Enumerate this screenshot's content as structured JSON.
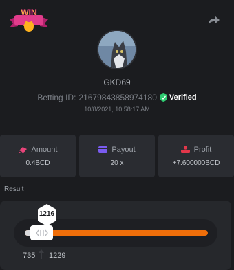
{
  "logo": {
    "text": "WIN"
  },
  "user": {
    "name": "GKD69",
    "betting_id_label": "Betting ID:",
    "betting_id": "21679843858974180",
    "verified": "Verified",
    "datetime": "10/8/2021, 10:58:17 AM"
  },
  "stats": {
    "amount_label": "Amount",
    "amount_value": "0.4BCD",
    "payout_label": "Payout",
    "payout_value": "20 x",
    "profit_label": "Profit",
    "profit_value": "+7.600000BCD"
  },
  "result": {
    "label": "Result",
    "value": "1216",
    "left_number": "735",
    "right_number": "1229"
  },
  "colors": {
    "accent": "#ef6e0a",
    "amount_icon": "#e8447a",
    "payout_icon": "#7a5cf0",
    "profit_icon": "#e2374a",
    "verified": "#2ecc71"
  }
}
